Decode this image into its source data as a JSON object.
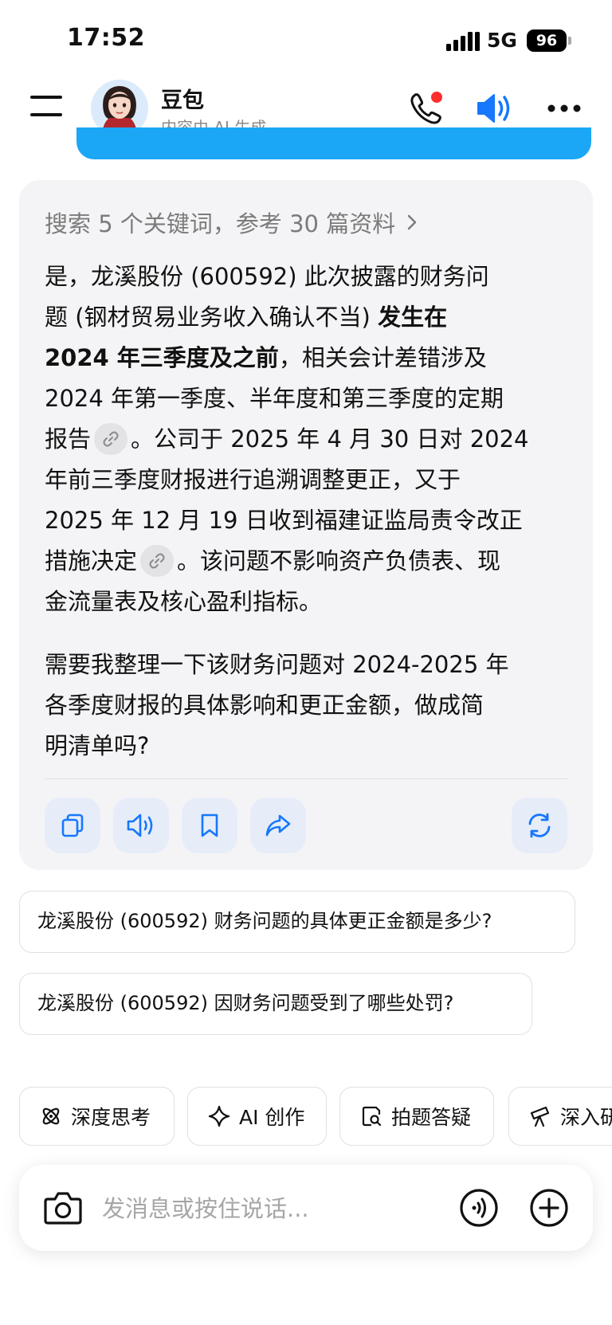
{
  "status_bar": {
    "time": "17:52",
    "network": "5G",
    "battery": "96"
  },
  "header": {
    "title": "豆包",
    "subtitle": "内容由 AI 生成"
  },
  "answer": {
    "search_summary": "搜索 5 个关键词，参考 30 篇资料",
    "p1": {
      "l1": "是，龙溪股份 (600592) 此次披露的财务问",
      "l2_normal": "题 (钢材贸易业务收入确认不当) ",
      "l2_bold": "发生在",
      "l3_bold": "2024 年三季度及之前",
      "l3_normal": "，相关会计差错涉及",
      "l4": "2024 年第一季度、半年度和第三季度的定期",
      "l5_a": "报告",
      "l5_b": "。公司于 2025 年 4 月 30 日对 2024",
      "l6": "年前三季度财报进行追溯调整更正，又于",
      "l7": "2025 年 12 月 19 日收到福建证监局责令改正",
      "l8_a": "措施决定",
      "l8_b": "。该问题不影响资产负债表、现",
      "l9": "金流量表及核心盈利指标。"
    },
    "p2": {
      "l1": "需要我整理一下该财务问题对 2024-2025 年",
      "l2": "各季度财报的具体影响和更正金额，做成简",
      "l3": "明清单吗?"
    }
  },
  "suggestions": [
    "龙溪股份 (600592) 财务问题的具体更正金额是多少?",
    "龙溪股份 (600592) 因财务问题受到了哪些处罚?"
  ],
  "tools": [
    {
      "label": "深度思考",
      "icon": "atom-icon"
    },
    {
      "label": "AI 创作",
      "icon": "sparkle-icon"
    },
    {
      "label": "拍题答疑",
      "icon": "scan-question-icon"
    },
    {
      "label": "深入研",
      "icon": "telescope-icon"
    }
  ],
  "input": {
    "placeholder": "发消息或按住说话..."
  },
  "colors": {
    "accent": "#1677ff",
    "bubble": "#1ba7f5",
    "card_bg": "#f4f4f6",
    "notify_dot": "#ff2d2d"
  }
}
